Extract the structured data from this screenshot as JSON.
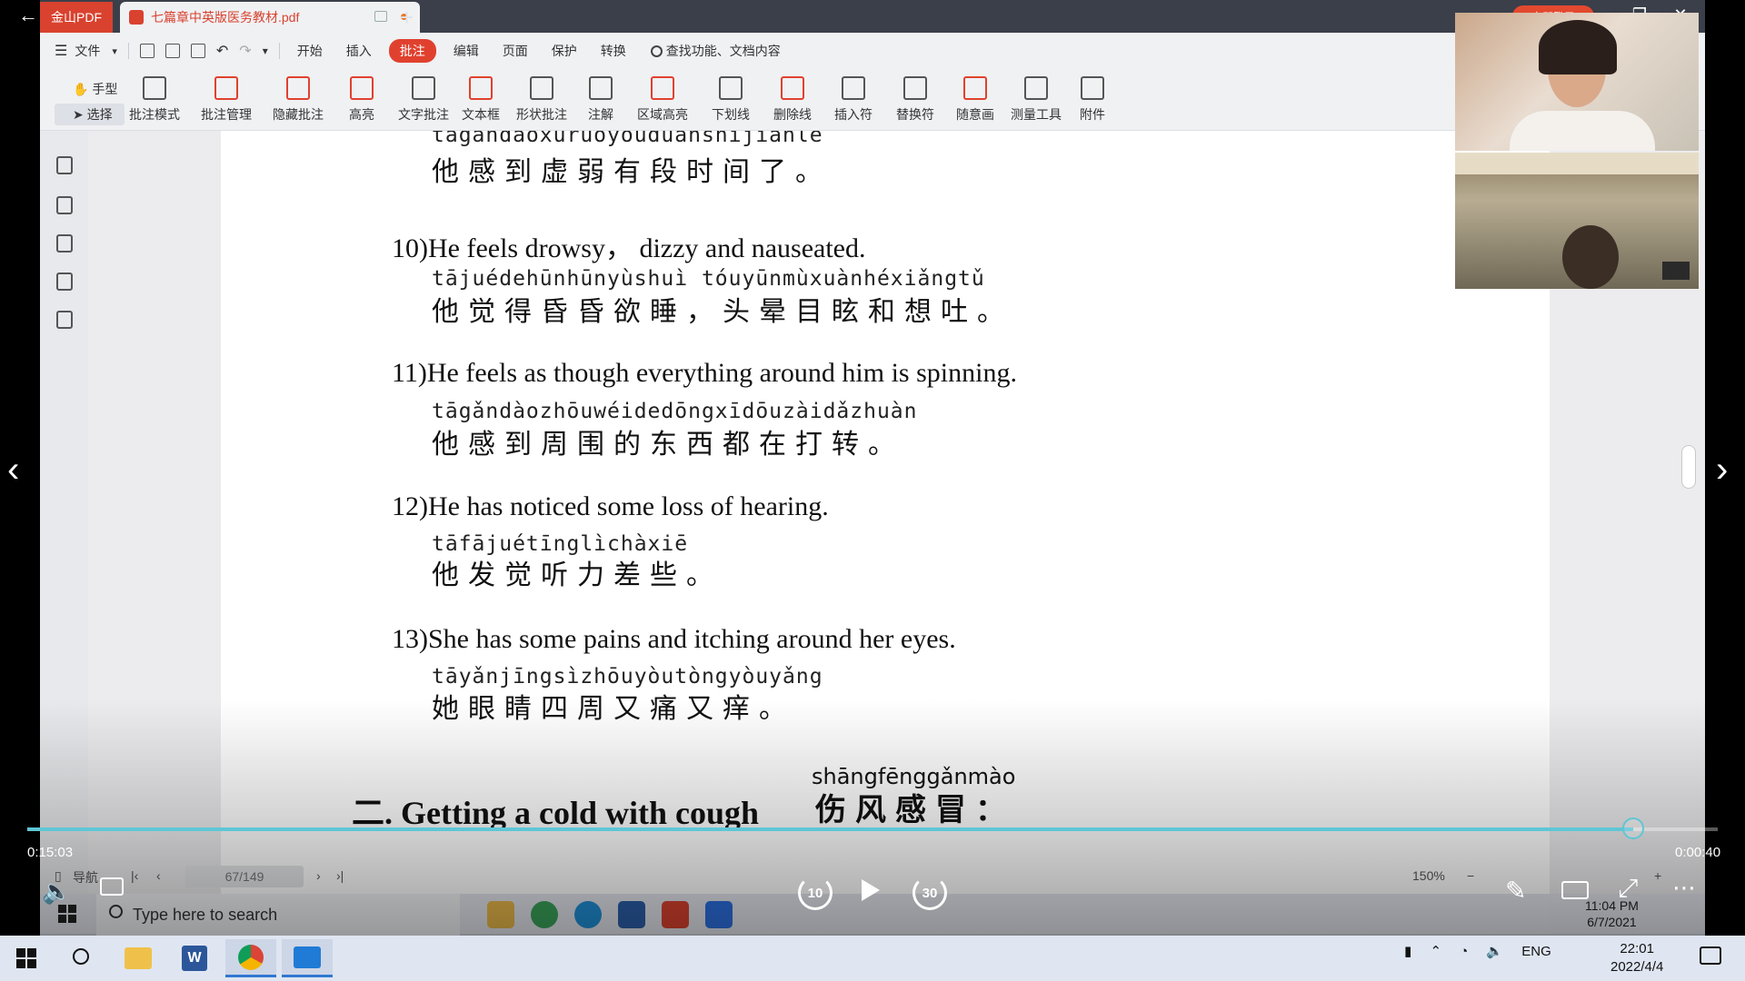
{
  "app": {
    "brand_tab": "金山PDF",
    "doc_tab": "七篇章中英版医务教材.pdf",
    "login_button": "立即登录",
    "menu": {
      "file": "文件",
      "items": [
        "开始",
        "插入",
        "批注",
        "编辑",
        "页面",
        "保护",
        "转换"
      ],
      "active": "批注",
      "search": "查找功能、文档内容"
    },
    "ribbon": {
      "hand": "手型",
      "select": "选择",
      "tools": [
        "批注模式",
        "批注管理",
        "隐藏批注",
        "高亮",
        "文字批注",
        "文本框",
        "形状批注",
        "注解",
        "区域高亮",
        "下划线",
        "删除线",
        "插入符",
        "替换符",
        "随意画",
        "测量工具",
        "附件"
      ]
    }
  },
  "document": {
    "top_partial_pinyin": "tāgǎndàoxūruòyǒuduànshíjiānle",
    "top_partial_hanzi": "他感到虚弱有段时间了。",
    "entries": [
      {
        "num": "10)",
        "english": "He feels drowsy， dizzy and nauseated.",
        "pinyin": "tājuédehūnhūnyùshuì   tóuyūnmùxuànhéxiǎngtǔ",
        "hanzi": "他觉得昏昏欲睡，头晕目眩和想吐。"
      },
      {
        "num": "11)",
        "english": "He feels as though everything around him is spinning.",
        "pinyin": "tāgǎndàozhōuwéidedōngxīdōuzàidǎzhuàn",
        "hanzi": "他感到周围的东西都在打转。"
      },
      {
        "num": "12)",
        "english": "He has noticed some loss of hearing.",
        "pinyin": "tāfājuétīnglìchàxiē",
        "hanzi": "他发觉听力差些。"
      },
      {
        "num": "13)",
        "english": "She has some pains and itching around her eyes.",
        "pinyin": "tāyǎnjīngsìzhōuyòutòngyòuyǎng",
        "hanzi": "她眼睛四周又痛又痒。"
      }
    ],
    "section": {
      "title": "二. Getting a cold with cough",
      "pinyin": "shāngfēnggǎnmào",
      "hanzi": "伤风感冒："
    }
  },
  "status_bar": {
    "nav_label": "导航",
    "page": "67/149",
    "zoom": "150%"
  },
  "inner_taskbar": {
    "search_placeholder": "Type here to search",
    "time": "11:04 PM",
    "date": "6/7/2021"
  },
  "video": {
    "current_time": "0:15:03",
    "remaining_time": "0:00:40",
    "progress": 0.95,
    "skip_back": "10",
    "skip_forward": "30"
  },
  "taskbar": {
    "lang": "ENG",
    "time": "22:01",
    "date": "2022/4/4"
  },
  "colors": {
    "accent": "#e0412e",
    "progress": "#5fc6d6"
  }
}
